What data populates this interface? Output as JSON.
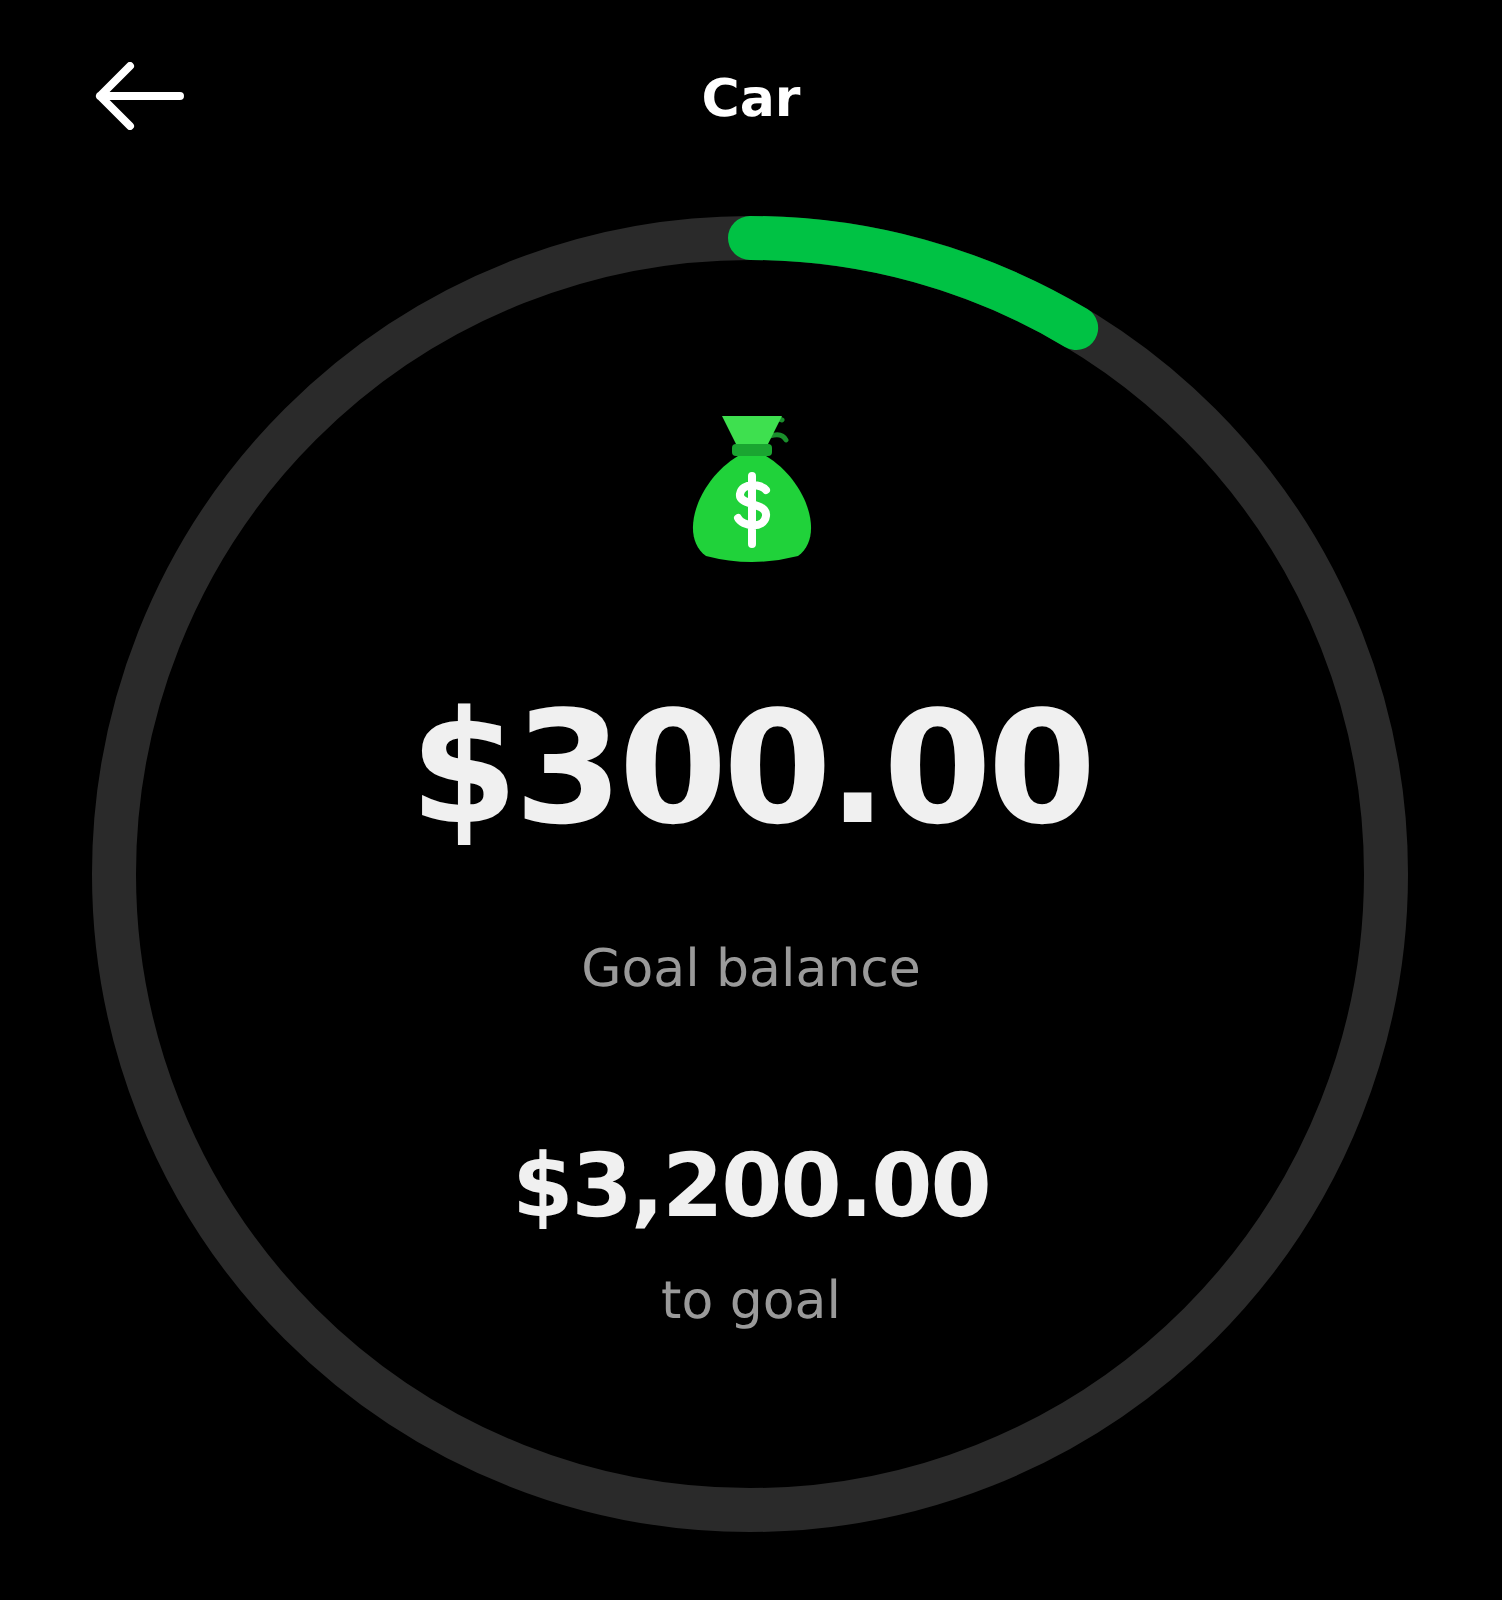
{
  "header": {
    "title": "Car"
  },
  "goal": {
    "balance": "$300.00",
    "balance_label": "Goal balance",
    "remaining": "$3,200.00",
    "remaining_label": "to goal"
  }
}
